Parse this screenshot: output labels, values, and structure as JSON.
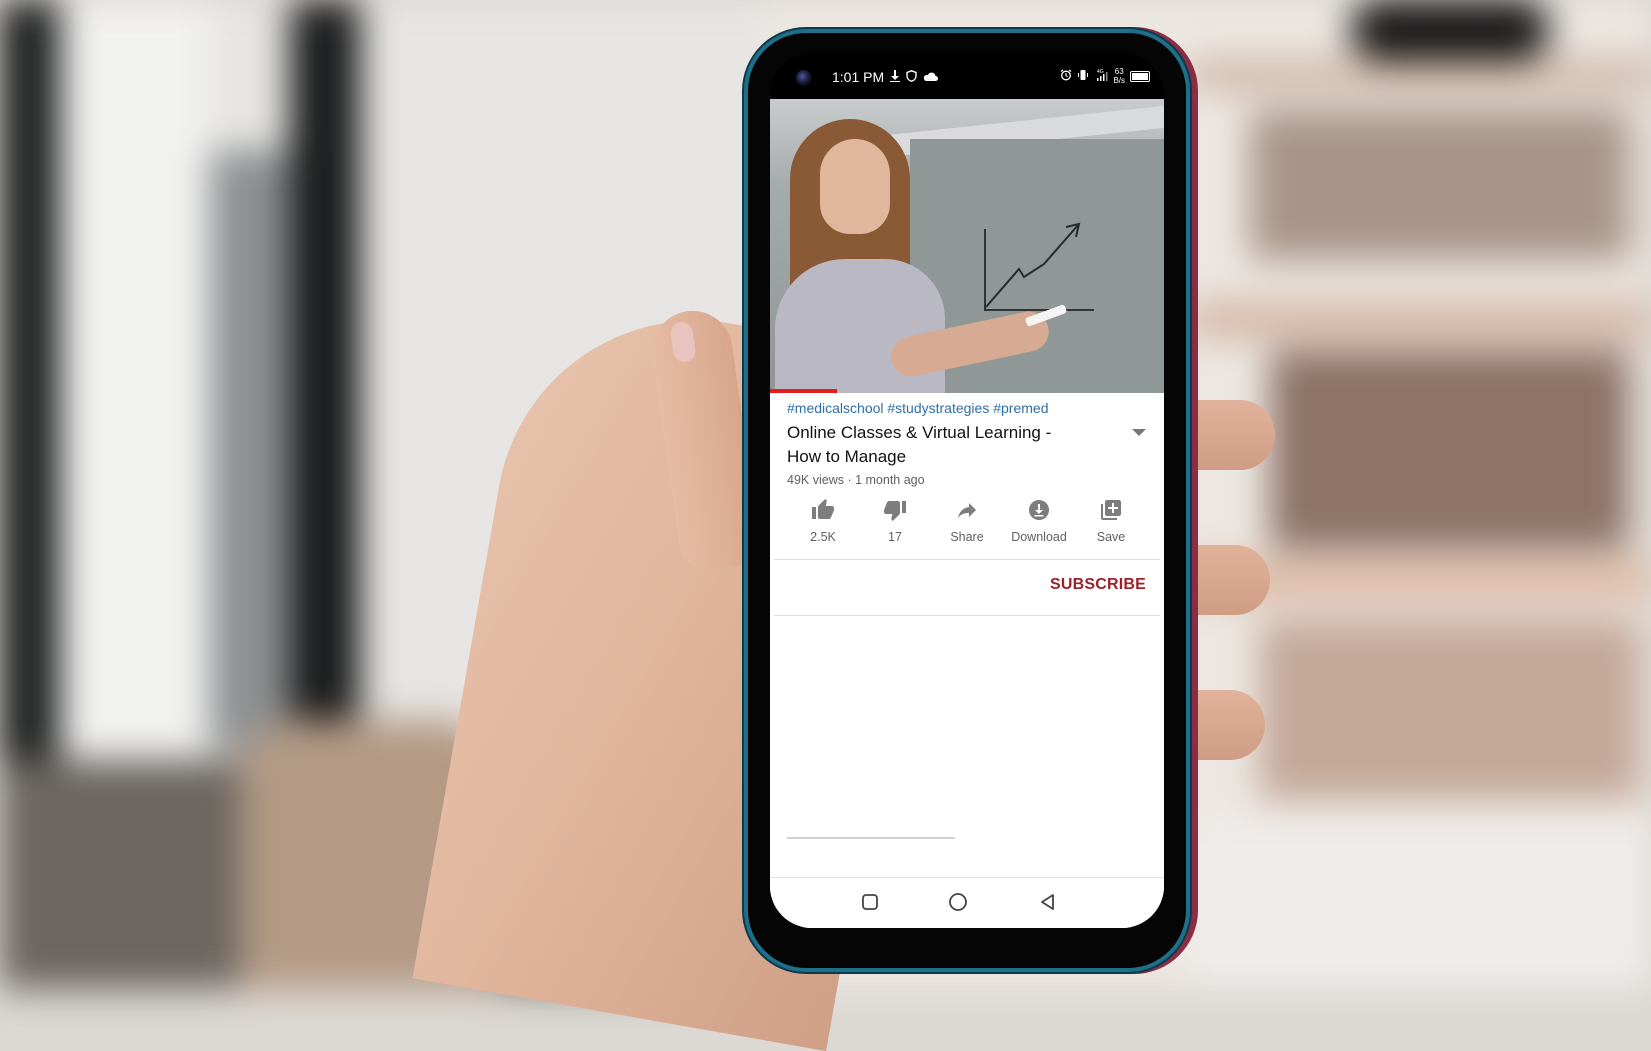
{
  "status_bar": {
    "time": "1:01 PM",
    "left_icons": [
      "download-icon",
      "shield-icon",
      "cloud-icon"
    ],
    "right_icons": [
      "alarm-icon",
      "vibrate-icon",
      "signal-icon",
      "battery-icon"
    ],
    "network": "4G",
    "net_speed_value": "63",
    "net_speed_unit": "B/s"
  },
  "video": {
    "progress_fraction": 0.17,
    "progress_color": "#e21f1f"
  },
  "details": {
    "hashtags": "#medicalschool #studystrategies #premed",
    "title": "Online Classes & Virtual Learning - How to Manage",
    "meta": "49K views · 1 month ago"
  },
  "actions": [
    {
      "icon": "thumbs-up-icon",
      "label": "2.5K"
    },
    {
      "icon": "thumbs-down-icon",
      "label": "17"
    },
    {
      "icon": "share-icon",
      "label": "Share"
    },
    {
      "icon": "download-circle-icon",
      "label": "Download"
    },
    {
      "icon": "add-to-playlist-icon",
      "label": "Save"
    }
  ],
  "channel": {
    "subscribe_label": "SUBSCRIBE",
    "subscribe_color": "#9e2129"
  },
  "navigation": {
    "buttons": [
      "recents",
      "home",
      "back"
    ]
  },
  "colors": {
    "hashtag": "#2f6fa5",
    "phone_frame": "#1f6f8a"
  }
}
